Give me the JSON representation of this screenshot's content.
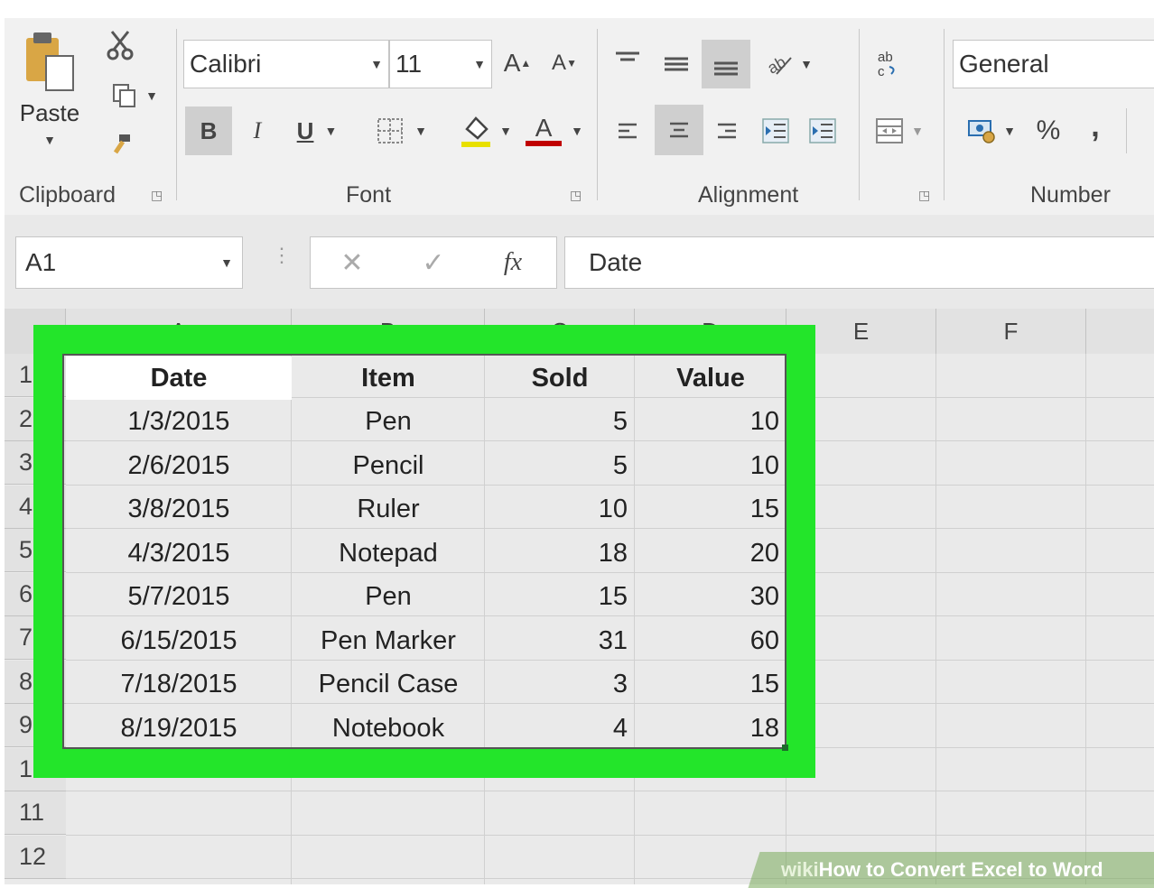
{
  "clipboard": {
    "paste_label": "Paste",
    "group_label": "Clipboard"
  },
  "font": {
    "name": "Calibri",
    "size": "11",
    "bold": "B",
    "italic": "I",
    "underline": "U",
    "font_color_glyph": "A",
    "grow_glyph": "A",
    "shrink_glyph": "A",
    "group_label": "Font"
  },
  "alignment": {
    "group_label": "Alignment"
  },
  "number": {
    "format": "General",
    "percent": "%",
    "comma": ",",
    "group_label": "Number"
  },
  "formula_bar": {
    "name_box": "A1",
    "fx": "fx",
    "content": "Date"
  },
  "columns": [
    "A",
    "B",
    "C",
    "D",
    "E",
    "F"
  ],
  "rows": [
    "1",
    "2",
    "3",
    "4",
    "5",
    "6",
    "7",
    "8",
    "9",
    "10",
    "11",
    "12"
  ],
  "table": {
    "headers": [
      "Date",
      "Item",
      "Sold",
      "Value"
    ],
    "rows": [
      [
        "1/3/2015",
        "Pen",
        "5",
        "10"
      ],
      [
        "2/6/2015",
        "Pencil",
        "5",
        "10"
      ],
      [
        "3/8/2015",
        "Ruler",
        "10",
        "15"
      ],
      [
        "4/3/2015",
        "Notepad",
        "18",
        "20"
      ],
      [
        "5/7/2015",
        "Pen",
        "15",
        "30"
      ],
      [
        "6/15/2015",
        "Pen Marker",
        "31",
        "60"
      ],
      [
        "7/18/2015",
        "Pencil Case",
        "3",
        "15"
      ],
      [
        "8/19/2015",
        "Notebook",
        "4",
        "18"
      ]
    ]
  },
  "watermark": {
    "wiki": "wiki",
    "text": "How to Convert Excel to Word"
  },
  "colors": {
    "highlight": "#23e52a",
    "font_red": "#c00000",
    "fill_yellow": "#e8e000"
  }
}
